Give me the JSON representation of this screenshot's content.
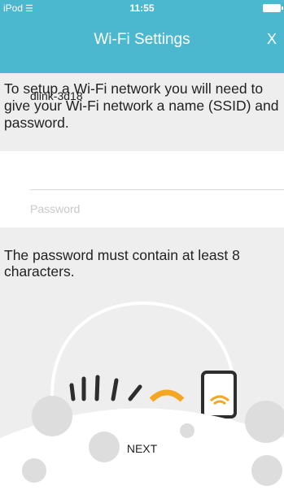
{
  "status_bar": {
    "carrier": "iPod",
    "time": "11:55"
  },
  "header": {
    "title": "Wi-Fi Settings",
    "close_label": "X"
  },
  "intro_text": "To setup a Wi-Fi network you will need to give your Wi-Fi network a name (SSID) and password.",
  "form": {
    "ssid_value": "dlink-3d18",
    "password_placeholder": "Password"
  },
  "hint_text": "The password must contain at least 8 characters.",
  "footer": {
    "next_label": "NEXT"
  },
  "colors": {
    "header_bg": "#4bb8cf",
    "accent_orange": "#f5a623"
  },
  "icons": [
    "wifi-icon",
    "battery-icon",
    "router-icon",
    "phone-icon"
  ]
}
